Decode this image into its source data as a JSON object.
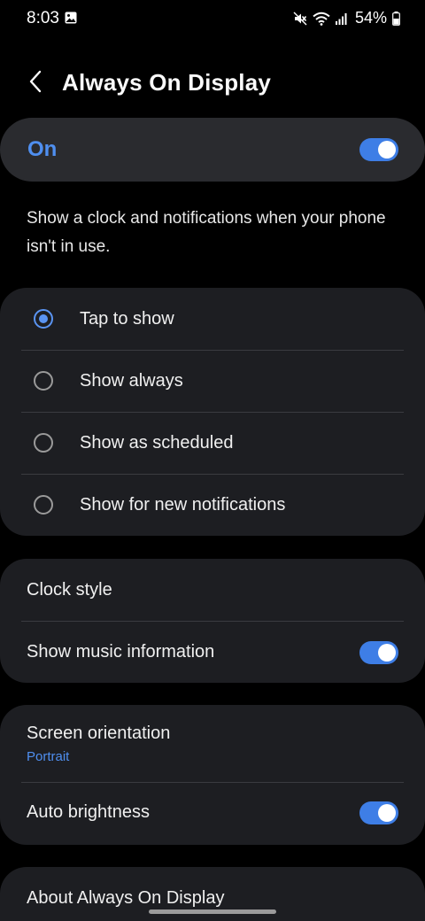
{
  "status_bar": {
    "time": "8:03",
    "battery": "54%",
    "icons": [
      "gallery-icon",
      "mute-icon",
      "wifi-icon",
      "signal-icon",
      "battery-icon"
    ]
  },
  "header": {
    "title": "Always On Display",
    "back_icon": "chevron-left-icon"
  },
  "master_switch": {
    "label": "On",
    "enabled": true
  },
  "description": "Show a clock and notifications when your phone isn't in use.",
  "display_mode": {
    "selected": "Tap to show",
    "options": [
      {
        "label": "Tap to show",
        "selected": true
      },
      {
        "label": "Show always",
        "selected": false
      },
      {
        "label": "Show as scheduled",
        "selected": false
      },
      {
        "label": "Show for new notifications",
        "selected": false
      }
    ]
  },
  "style_group": {
    "clock_style": "Clock style",
    "music_info": {
      "label": "Show music information",
      "enabled": true
    }
  },
  "display_group": {
    "orientation": {
      "label": "Screen orientation",
      "value": "Portrait"
    },
    "auto_brightness": {
      "label": "Auto brightness",
      "enabled": true
    }
  },
  "about": {
    "label": "About Always On Display"
  },
  "colors": {
    "accent": "#4f8ff0",
    "toggle_on": "#3e7ee6",
    "card_bg": "#1d1e22",
    "master_bg": "#2a2b2f",
    "background": "#000000"
  }
}
